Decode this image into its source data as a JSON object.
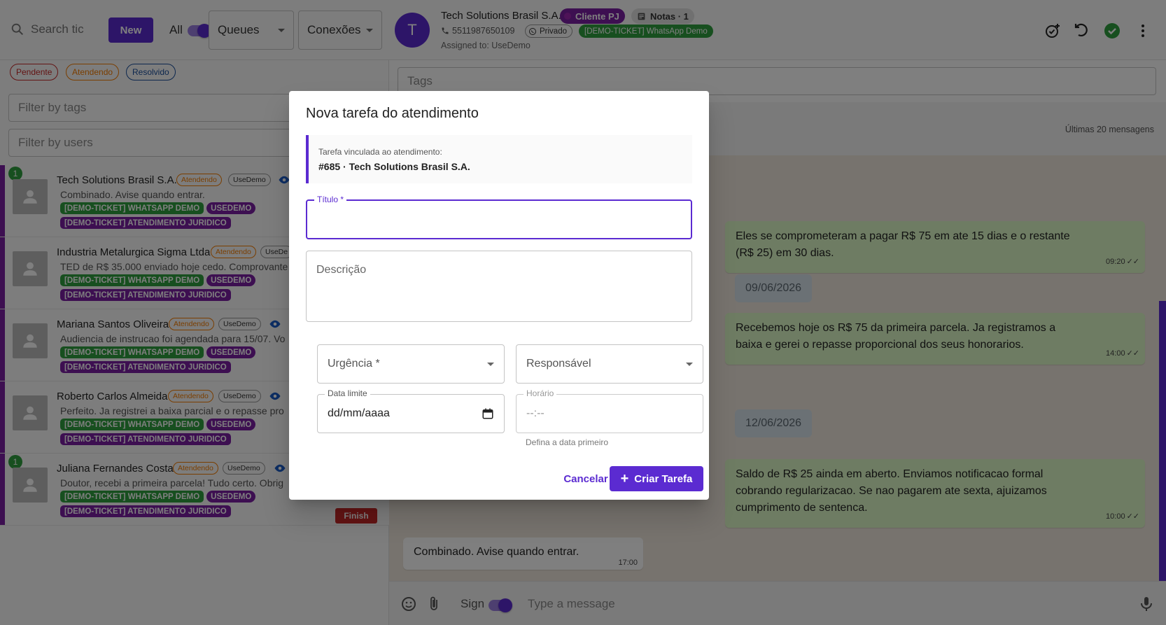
{
  "left": {
    "search_placeholder": "Search tic",
    "new_label": "New",
    "all_label": "All",
    "queues_label": "Queues",
    "connections_label": "Conexões",
    "status_chips": [
      "Pendente",
      "Atendendo",
      "Resolvido"
    ],
    "filter_tags_placeholder": "Filter by tags",
    "filter_users_placeholder": "Filter by users",
    "finish_label": "Finish",
    "tickets": [
      {
        "name": "Tech Solutions Brasil S.A.",
        "status": "Atendendo",
        "user": "UseDemo",
        "preview": "Combinado. Avise quando entrar.",
        "badge": "1"
      },
      {
        "name": "Industria Metalurgica Sigma Ltda",
        "status": "Atendendo",
        "user": "UseDe",
        "preview": "TED de R$ 35.000 enviado hoje cedo. Comprovante",
        "badge": ""
      },
      {
        "name": "Mariana Santos Oliveira",
        "status": "Atendendo",
        "user": "UseDemo",
        "preview": "Audiencia de instrucao foi agendada para 15/07. Vo",
        "badge": ""
      },
      {
        "name": "Roberto Carlos Almeida",
        "status": "Atendendo",
        "user": "UseDemo",
        "preview": "Perfeito. Ja registrei a baixa parcial e o repasse pro",
        "badge": ""
      },
      {
        "name": "Juliana Fernandes Costa",
        "status": "Atendendo",
        "user": "UseDemo",
        "preview": "Doutor, recebi a primeira parcela! Tudo certo. Obrig",
        "badge": "1"
      }
    ],
    "tag_whatsapp": "[DEMO-TICKET] WHATSAPP DEMO",
    "tag_usedemo": "USEDEMO",
    "tag_juridico": "[DEMO-TICKET] ATENDIMENTO JURIDICO"
  },
  "header": {
    "avatar_letter": "T",
    "name": "Tech Solutions Brasil S.A.",
    "chip_client": "Cliente PJ",
    "chip_notes": "Notas · 1",
    "phone": "5511987650109",
    "chip_private": "Privado",
    "chip_connection": "[DEMO-TICKET] WhatsApp Demo",
    "assigned": "Assigned to: UseDemo"
  },
  "chat": {
    "tags_placeholder": "Tags",
    "last_messages": "Últimas 20 mensagens",
    "messages": [
      {
        "text": "Eles se comprometeram a pagar R$ 75 em ate 15 dias e o restante (R$ 25) em 30 dias.",
        "time": "09:20"
      },
      {
        "text": "Recebemos hoje os R$ 75 da primeira parcela. Ja registramos a baixa e gerei o repasse proporcional dos seus honorarios.",
        "time": "14:00"
      },
      {
        "text": "Saldo de R$ 25 ainda em aberto. Enviamos notificacao formal cobrando regularizacao. Se nao pagarem ate sexta, ajuizamos cumprimento de sentenca.",
        "time": "10:00"
      }
    ],
    "dates": [
      "09/06/2026",
      "12/06/2026"
    ],
    "incoming": {
      "text": "Combinado. Avise quando entrar.",
      "time": "17:00"
    },
    "sign_label": "Sign",
    "input_placeholder": "Type a message"
  },
  "dialog": {
    "title": "Nova tarefa do atendimento",
    "linked_label": "Tarefa vinculada ao atendimento:",
    "linked_value": "#685 · Tech Solutions Brasil S.A.",
    "titulo_label": "Título *",
    "titulo_value": "",
    "descricao_placeholder": "Descrição",
    "urgencia_label": "Urgência *",
    "responsavel_label": "Responsável",
    "data_label": "Data limite",
    "data_value": "dd/mm/aaaa",
    "horario_label": "Horário",
    "horario_value": "--:--",
    "horario_hint": "Defina a data primeiro",
    "cancel_label": "Cancelar",
    "create_label": "Criar Tarefa"
  }
}
